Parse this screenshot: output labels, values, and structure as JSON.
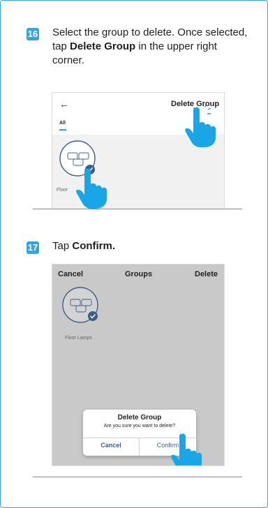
{
  "step16": {
    "number": "16",
    "text_1": "Select the group to delete. Once selected, tap ",
    "text_bold": "Delete Group",
    "text_2": " in the upper right corner.",
    "screen": {
      "back": "←",
      "action": "Delete Group",
      "tab": "All",
      "group_caption": "Floor"
    }
  },
  "step17": {
    "number": "17",
    "text_1": "Tap ",
    "text_bold": "Confirm.",
    "screen": {
      "cancel": "Cancel",
      "title": "Groups",
      "delete": "Delete",
      "group_caption": "Floor Lamps",
      "dialog": {
        "title": "Delete Group",
        "message": "Are you sure you want to delete?",
        "cancel": "Cancel",
        "confirm": "Confirm"
      }
    }
  },
  "colors": {
    "accent": "#35a3df",
    "hand": "#1aa6e6",
    "check": "#3d5f86"
  }
}
